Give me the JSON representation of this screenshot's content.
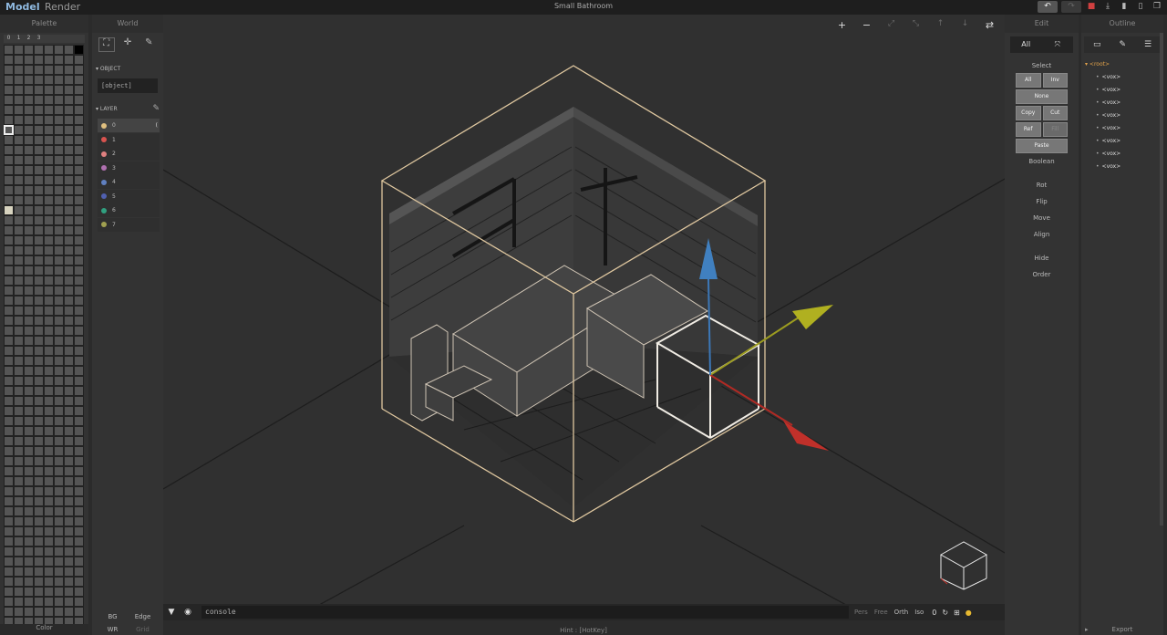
{
  "app": {
    "mode_model": "Model",
    "mode_render": "Render",
    "project_title": "Small Bathroom",
    "hint": "Hint : [HotKey]"
  },
  "topbar_icons": [
    "undo-icon",
    "redo-icon",
    "save-icon",
    "download-icon",
    "new-file-icon",
    "open-file-icon",
    "duplicate-icon"
  ],
  "palette": {
    "title": "Palette",
    "columns": [
      "0",
      "1",
      "2",
      "3"
    ],
    "footer": "Color"
  },
  "world": {
    "title": "World",
    "tools": [
      "select-icon",
      "move-icon",
      "pencil-icon"
    ],
    "object_label": "OBJECT",
    "object_value": "[object]",
    "layer_label": "LAYER",
    "layers": [
      {
        "name": "0",
        "color": "#e0c080",
        "active": true
      },
      {
        "name": "1",
        "color": "#d9534f"
      },
      {
        "name": "2",
        "color": "#e08080"
      },
      {
        "name": "3",
        "color": "#b070b0"
      },
      {
        "name": "4",
        "color": "#6080c0"
      },
      {
        "name": "5",
        "color": "#5060b0"
      },
      {
        "name": "6",
        "color": "#30a080"
      },
      {
        "name": "7",
        "color": "#a0a050"
      }
    ],
    "bottom": {
      "bg": "BG",
      "edge": "Edge",
      "wr": "WR",
      "grid": "Grid"
    }
  },
  "viewport": {
    "tools": {
      "zoom_in": "+",
      "zoom_out": "−",
      "swap": "⇄"
    },
    "console_placeholder": "console",
    "views": [
      "Pers",
      "Free",
      "Orth",
      "Iso"
    ],
    "views_value": "0"
  },
  "edit": {
    "title": "Edit",
    "top": [
      "All"
    ],
    "select_label": "Select",
    "buttons": {
      "all": "All",
      "inv": "Inv",
      "none": "None",
      "copy": "Copy",
      "cut": "Cut",
      "ref": "Ref",
      "fill": "Fill",
      "paste": "Paste"
    },
    "boolean": "Boolean",
    "actions": [
      "Rot",
      "Flip",
      "Move",
      "Align"
    ],
    "actions2": [
      "Hide",
      "Order"
    ]
  },
  "outline": {
    "title": "Outline",
    "root": "<root>",
    "items": [
      "<vox>",
      "<vox>",
      "<vox>",
      "<vox>",
      "<vox>",
      "<vox>",
      "<vox>",
      "<vox>"
    ],
    "footer": "Export"
  },
  "colors": {
    "accent": "#8fb9e0",
    "selection": "#e0c8a0",
    "axis_x": "#c0302a",
    "axis_y": "#b0b020",
    "axis_z": "#4080c0"
  }
}
